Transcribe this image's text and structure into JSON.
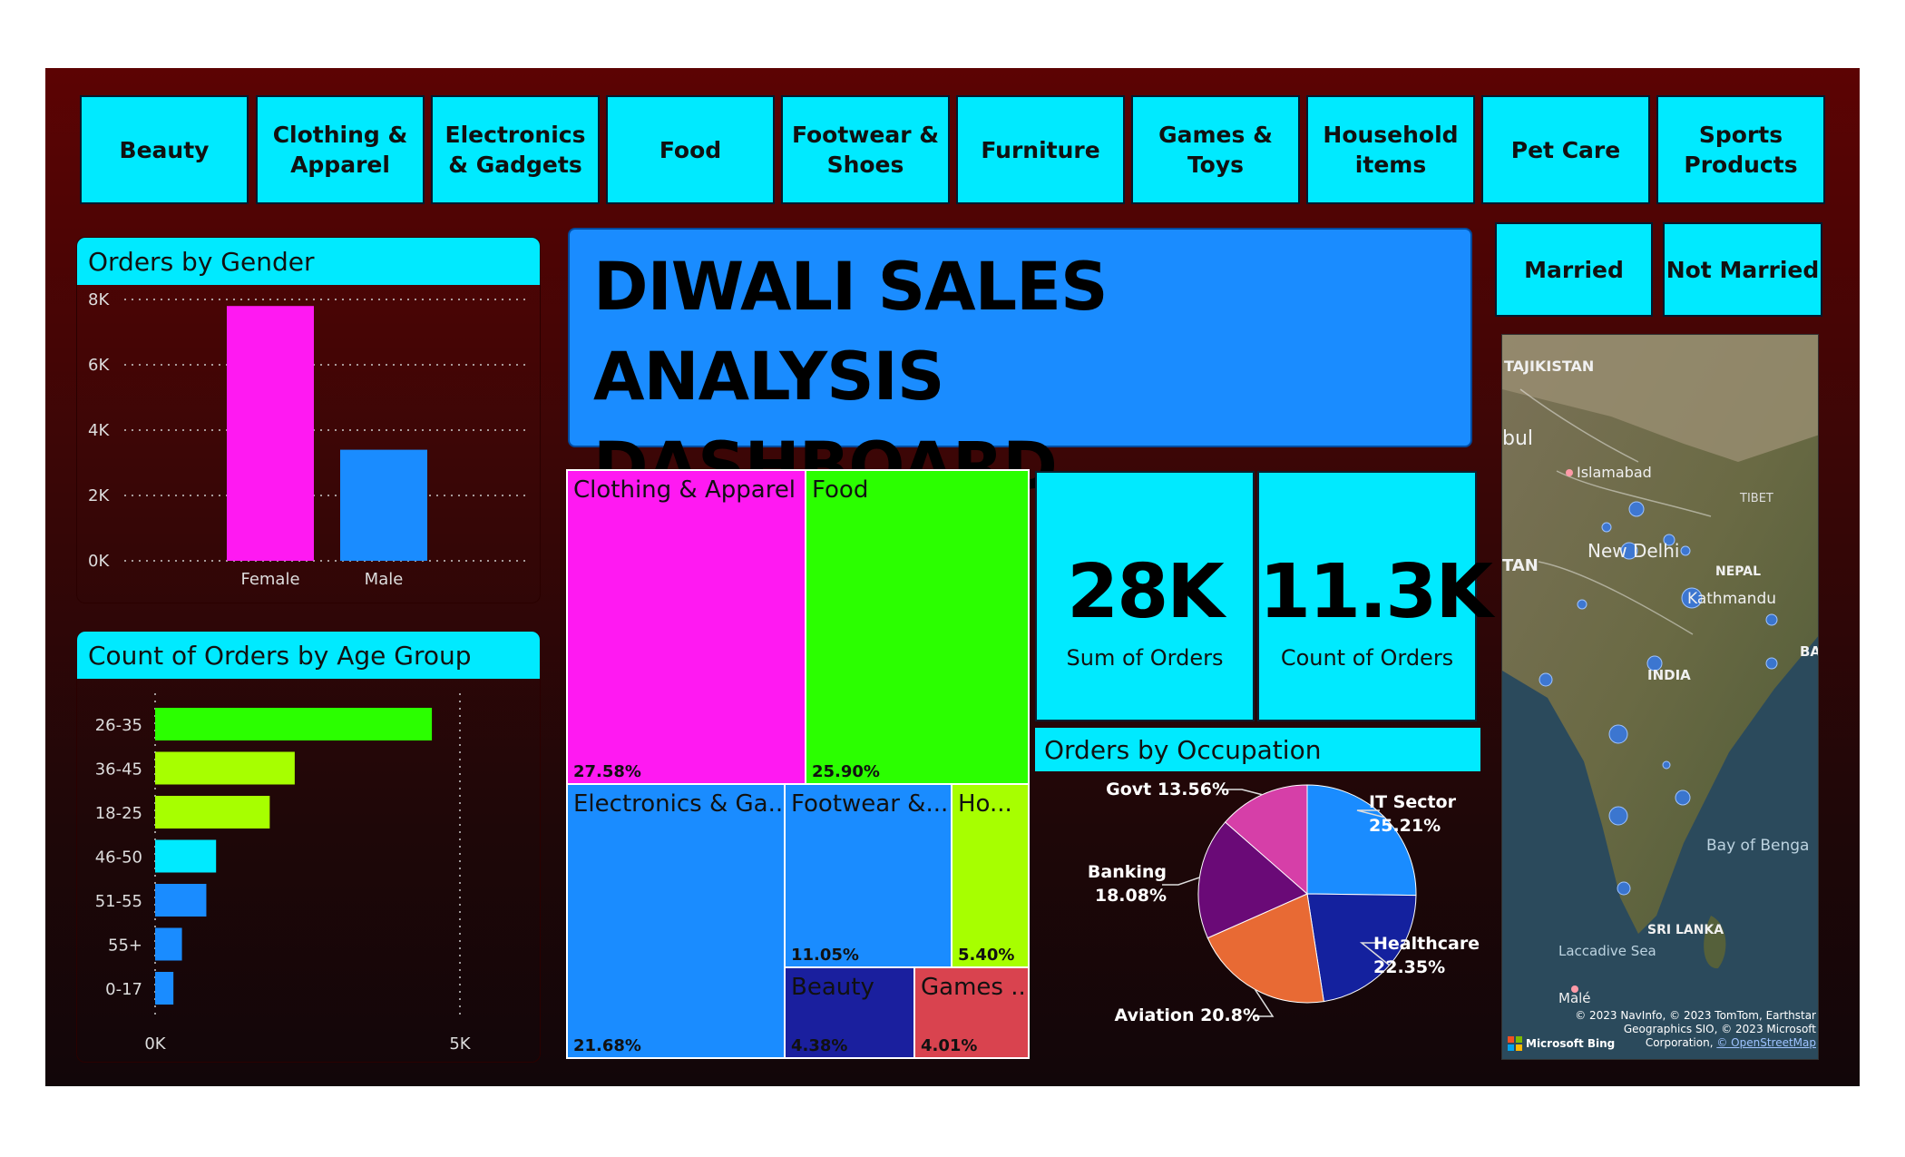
{
  "slicers": [
    "Beauty",
    "Clothing & Apparel",
    "Electronics & Gadgets",
    "Food",
    "Footwear & Shoes",
    "Furniture",
    "Games & Toys",
    "Household items",
    "Pet Care",
    "Sports Products"
  ],
  "marital_slicers": [
    "Married",
    "Not Married"
  ],
  "title": {
    "line1": "DIWALI SALES ANALYSIS",
    "line2": "DASHBOARD"
  },
  "colors": {
    "accent": "#00eaff",
    "title_bg": "#1a8cff",
    "bg_top": "#5c0303",
    "bg_bottom": "#120609"
  },
  "gender_chart": {
    "title": "Orders by Gender",
    "chart_data": {
      "type": "bar",
      "categories": [
        "Female",
        "Male"
      ],
      "values": [
        7800,
        3400
      ],
      "colors": [
        "#ff19f2",
        "#1a8cff"
      ],
      "y_ticks": [
        "0K",
        "2K",
        "4K",
        "6K",
        "8K"
      ],
      "ylim": [
        0,
        8000
      ],
      "grid": true
    }
  },
  "age_chart": {
    "title": "Count of Orders by Age Group",
    "chart_data": {
      "type": "bar",
      "orientation": "horizontal",
      "categories": [
        "26-35",
        "36-45",
        "18-25",
        "46-50",
        "51-55",
        "55+",
        "0-17"
      ],
      "values": [
        4540,
        2290,
        1880,
        1000,
        840,
        440,
        300
      ],
      "colors": [
        "#2bff00",
        "#a7ff00",
        "#a7ff00",
        "#00eaff",
        "#1a8cff",
        "#1a8cff",
        "#1a8cff"
      ],
      "x_ticks": [
        "0K",
        "5K"
      ],
      "xlim": [
        0,
        5000
      ]
    }
  },
  "treemap": [
    {
      "label": "Clothing & Apparel",
      "pct": "27.58%",
      "color": "#ff19f2"
    },
    {
      "label": "Food",
      "pct": "25.90%",
      "color": "#2bff00"
    },
    {
      "label": "Electronics & Ga...",
      "pct": "21.68%",
      "color": "#1a8cff"
    },
    {
      "label": "Footwear &...",
      "pct": "11.05%",
      "color": "#1a8cff"
    },
    {
      "label": "Ho...",
      "pct": "5.40%",
      "color": "#a7ff00"
    },
    {
      "label": "Beauty",
      "pct": "4.38%",
      "color": "#1a1f9e"
    },
    {
      "label": "Games ...",
      "pct": "4.01%",
      "color": "#d9434f"
    }
  ],
  "cards": [
    {
      "value": "28K",
      "caption": "Sum of Orders"
    },
    {
      "value": "11.3K",
      "caption": "Count of Orders"
    }
  ],
  "occupation_chart": {
    "title": "Orders by Occupation",
    "chart_data": {
      "type": "pie",
      "slices": [
        {
          "name": "IT Sector",
          "value": 25.21,
          "label_name": "IT Sector",
          "label_pct": "25.21%",
          "color": "#1a8cff"
        },
        {
          "name": "Healthcare",
          "value": 22.35,
          "label_name": "Healthcare",
          "label_pct": "22.35%",
          "color": "#14219e"
        },
        {
          "name": "Aviation",
          "value": 20.8,
          "label_name": "Aviation 20.8%",
          "label_pct": "",
          "color": "#e86a34"
        },
        {
          "name": "Banking",
          "value": 18.08,
          "label_name": "Banking",
          "label_pct": "18.08%",
          "color": "#6a0a77"
        },
        {
          "name": "Govt",
          "value": 13.56,
          "label_name": "Govt 13.56%",
          "label_pct": "",
          "color": "#d63fa8"
        }
      ]
    }
  },
  "map": {
    "labels": [
      "TAJIKISTAN",
      "bul",
      "Islamabad",
      "TIBET",
      "TAN",
      "New Delhi",
      "NEPAL",
      "Kathmandu",
      "BA",
      "INDIA",
      "Bay of Benga",
      "SRI LANKA",
      "Laccadive Sea",
      "Malé"
    ],
    "attribution": [
      "© 2023 NavInfo, © 2023 TomTom, Earthstar",
      "Geographics SIO, © 2023 Microsoft",
      "Corporation,",
      "© OpenStreetMap"
    ],
    "logo_text": "Microsoft Bing"
  }
}
